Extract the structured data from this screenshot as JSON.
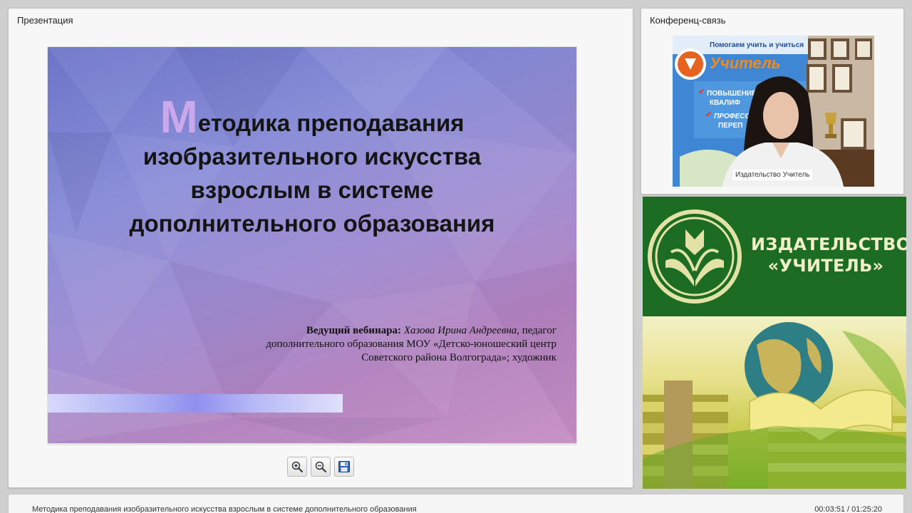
{
  "presentation_panel": {
    "title": "Презентация"
  },
  "slide": {
    "title_dropcap": "М",
    "title_line1_rest": "етодика преподавания",
    "title_line2": "изобразительного искусства",
    "title_line3": "взрослым в системе",
    "title_line4": "дополнительного образования",
    "host_label": "Ведущий вебинара:",
    "host_name": "Хазова Ирина Андреевна,",
    "host_role": "педагог",
    "host_line2": "дополнительного образования МОУ «Детско-юношеский центр",
    "host_line3": "Советского района Волгограда»; художник"
  },
  "toolbar": {
    "zoom_in_icon": "zoom-in-icon",
    "zoom_out_icon": "zoom-out-icon",
    "save_icon": "floppy-disk-icon"
  },
  "conference_panel": {
    "title": "Конференц-связь",
    "video_label": "Издательство Учитель"
  },
  "video_backdrop": {
    "poster_line1": "Помогаем учить и учиться",
    "poster_brand": "Учитель",
    "poster_item1": "ПОВЫШЕНИЕ",
    "poster_item1b": "КВАЛИФ",
    "poster_item2": "ПРОФЕСС",
    "poster_item2b": "ПЕРЕП"
  },
  "publisher_banner": {
    "name_line1": "ИЗДАТЕЛЬСТВО",
    "name_line2": "«УЧИТЕЛЬ»"
  },
  "status_bar": {
    "title": "Методика преподавания изобразительного искусства  взрослым в системе дополнительного образования",
    "time": "00:03:51 / 01:25:20"
  },
  "colors": {
    "banner_green": "#1c6c23",
    "banner_text": "#f1efc8",
    "dropcap": "#c9a8ec"
  }
}
